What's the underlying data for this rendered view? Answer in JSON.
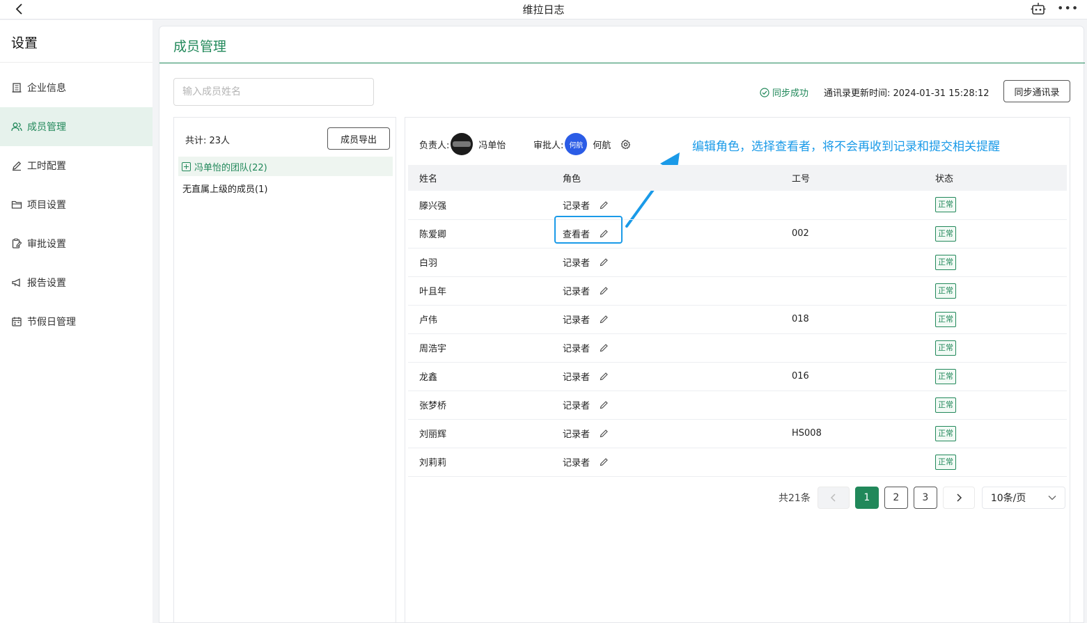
{
  "topbar": {
    "title": "维拉日志"
  },
  "sidebar": {
    "title": "设置",
    "items": [
      {
        "label": "企业信息",
        "icon": "building-icon"
      },
      {
        "label": "成员管理",
        "icon": "users-icon",
        "active": true
      },
      {
        "label": "工时配置",
        "icon": "pencil-icon"
      },
      {
        "label": "项目设置",
        "icon": "folder-icon"
      },
      {
        "label": "审批设置",
        "icon": "clipboard-edit-icon"
      },
      {
        "label": "报告设置",
        "icon": "megaphone-icon"
      },
      {
        "label": "节假日管理",
        "icon": "calendar-icon"
      }
    ]
  },
  "page": {
    "title": "成员管理"
  },
  "search": {
    "placeholder": "输入成员姓名"
  },
  "sync": {
    "status": "同步成功",
    "time": "通讯录更新时间: 2024-01-31 15:28:12",
    "button": "同步通讯录"
  },
  "tree": {
    "total": "共计: 23人",
    "export": "成员导出",
    "nodes": [
      "冯单怡的团队(22)",
      "无直属上级的成员(1)"
    ]
  },
  "panel": {
    "owner_label": "负责人:",
    "owner_name": "冯单怡",
    "approver_label": "审批人:",
    "approver_avatar": "何航",
    "approver_name": "何航",
    "callout": "编辑角色，选择查看者，将不会再收到记录和提交相关提醒"
  },
  "table": {
    "headers": [
      "姓名",
      "角色",
      "工号",
      "状态"
    ],
    "rows": [
      {
        "name": "滕兴强",
        "role": "记录者",
        "id": "",
        "status": "正常"
      },
      {
        "name": "陈爱卿",
        "role": "查看者",
        "id": "002",
        "status": "正常"
      },
      {
        "name": "白羽",
        "role": "记录者",
        "id": "",
        "status": "正常"
      },
      {
        "name": "叶且年",
        "role": "记录者",
        "id": "",
        "status": "正常"
      },
      {
        "name": "卢伟",
        "role": "记录者",
        "id": "018",
        "status": "正常"
      },
      {
        "name": "周浩宇",
        "role": "记录者",
        "id": "",
        "status": "正常"
      },
      {
        "name": "龙鑫",
        "role": "记录者",
        "id": "016",
        "status": "正常"
      },
      {
        "name": "张梦桥",
        "role": "记录者",
        "id": "",
        "status": "正常"
      },
      {
        "name": "刘丽辉",
        "role": "记录者",
        "id": "HS008",
        "status": "正常"
      },
      {
        "name": "刘莉莉",
        "role": "记录者",
        "id": "",
        "status": "正常"
      }
    ]
  },
  "pagination": {
    "total": "共21条",
    "pages": [
      "1",
      "2",
      "3"
    ],
    "current": "1",
    "page_size": "10条/页"
  },
  "colors": {
    "accent": "#21885a",
    "callout": "#1a9ae8"
  }
}
